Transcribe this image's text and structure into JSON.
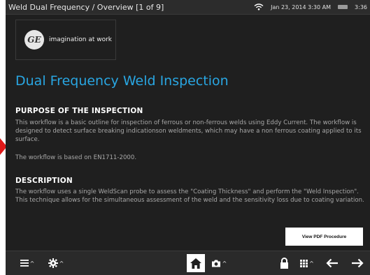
{
  "statusbar": {
    "breadcrumb": "Weld Dual Frequency  / Overview  [1 of 9]",
    "datetime": "Jan 23, 2014 3:30 AM",
    "battery_text": "3:36"
  },
  "logo": {
    "mark": "GE",
    "tagline": "imagination at work"
  },
  "page": {
    "title": "Dual Frequency Weld Inspection",
    "purpose_heading": "PURPOSE OF THE INSPECTION",
    "purpose_text": "This workflow is a basic outline for inspection of ferrous or non-ferrous welds using Eddy Current. The workflow is designed to detect surface breaking indicationson weldments, which may have a non ferrous coating applied to its surface.",
    "standard_text": "The workflow is based on EN1711-2000.",
    "description_heading": "DESCRIPTION",
    "description_text": "The workflow uses a single WeldScan probe to assess the \"Coating Thickness\" and perform the \"Weld Inspection\". This technique allows for the simultaneous assessment of the weld and the sensitivity loss due to coating variation.",
    "pdf_button": "View PDF Procedure"
  },
  "toolbar": {
    "menu_icon": "menu-icon",
    "settings_icon": "gear-icon",
    "home_icon": "home-icon",
    "camera_icon": "camera-icon",
    "lock_icon": "lock-icon",
    "grid_icon": "grid-icon",
    "back_icon": "arrow-left-icon",
    "forward_icon": "arrow-right-icon"
  },
  "colors": {
    "title": "#29a6e2",
    "background": "#1f1f1f",
    "marker": "#e01818"
  }
}
